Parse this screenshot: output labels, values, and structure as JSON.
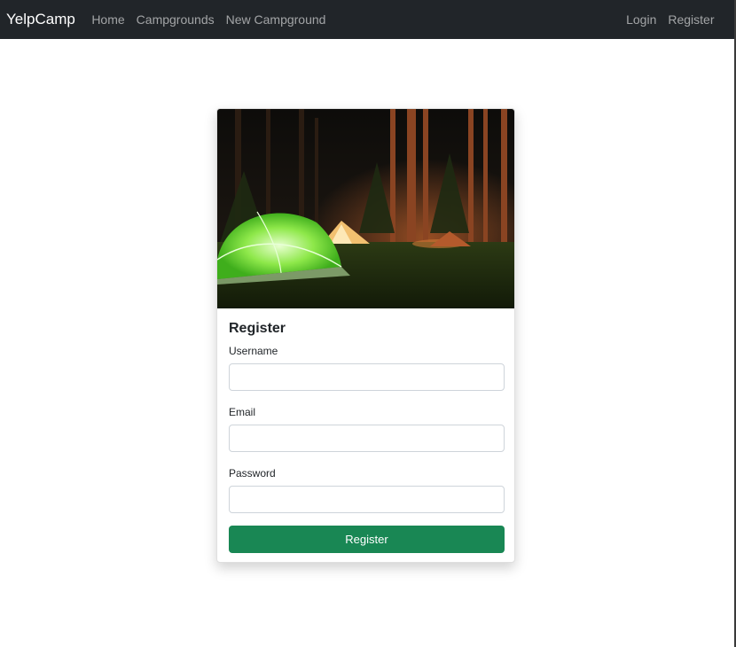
{
  "navbar": {
    "brand": "YelpCamp",
    "links": [
      {
        "label": "Home"
      },
      {
        "label": "Campgrounds"
      },
      {
        "label": "New Campground"
      }
    ],
    "auth_links": [
      {
        "label": "Login"
      },
      {
        "label": "Register"
      }
    ]
  },
  "card": {
    "title": "Register",
    "fields": [
      {
        "label": "Username",
        "value": "",
        "type": "text"
      },
      {
        "label": "Email",
        "value": "",
        "type": "email"
      },
      {
        "label": "Password",
        "value": "",
        "type": "password"
      }
    ],
    "submit_label": "Register"
  },
  "colors": {
    "navbar_bg": "#212529",
    "submit_bg": "#198754"
  }
}
